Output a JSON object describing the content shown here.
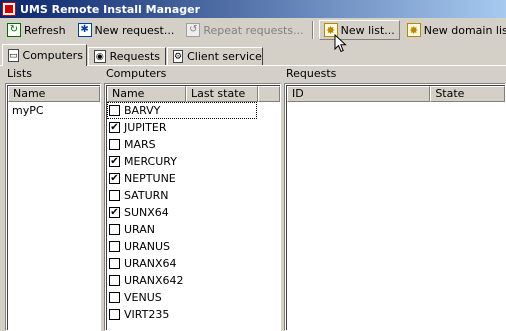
{
  "window": {
    "title": "UMS Remote Install Manager"
  },
  "toolbar": {
    "refresh_label": "Refresh",
    "new_request_label": "New request...",
    "repeat_requests_label": "Repeat requests...",
    "new_list_label": "New list...",
    "new_domain_list_label": "New domain list..."
  },
  "tabs": [
    {
      "label": "Computers",
      "icon": "computer-icon"
    },
    {
      "label": "Requests",
      "icon": "requests-icon"
    },
    {
      "label": "Client service",
      "icon": "gear-icon"
    }
  ],
  "lists_panel": {
    "label": "Lists",
    "columns": [
      "Name"
    ],
    "items": [
      "myPC"
    ]
  },
  "computers_panel": {
    "label": "Computers",
    "columns": [
      "Name",
      "Last state"
    ],
    "items": [
      {
        "name": "BARVY",
        "checked": false,
        "state": ""
      },
      {
        "name": "JUPITER",
        "checked": true,
        "state": ""
      },
      {
        "name": "MARS",
        "checked": false,
        "state": ""
      },
      {
        "name": "MERCURY",
        "checked": true,
        "state": ""
      },
      {
        "name": "NEPTUNE",
        "checked": true,
        "state": ""
      },
      {
        "name": "SATURN",
        "checked": false,
        "state": ""
      },
      {
        "name": "SUNX64",
        "checked": true,
        "state": ""
      },
      {
        "name": "URAN",
        "checked": false,
        "state": ""
      },
      {
        "name": "URANUS",
        "checked": false,
        "state": ""
      },
      {
        "name": "URANX64",
        "checked": false,
        "state": ""
      },
      {
        "name": "URANX642",
        "checked": false,
        "state": ""
      },
      {
        "name": "VENUS",
        "checked": false,
        "state": ""
      },
      {
        "name": "VIRT235",
        "checked": false,
        "state": ""
      }
    ]
  },
  "requests_panel": {
    "label": "Requests",
    "columns": [
      "ID",
      "State"
    ]
  }
}
